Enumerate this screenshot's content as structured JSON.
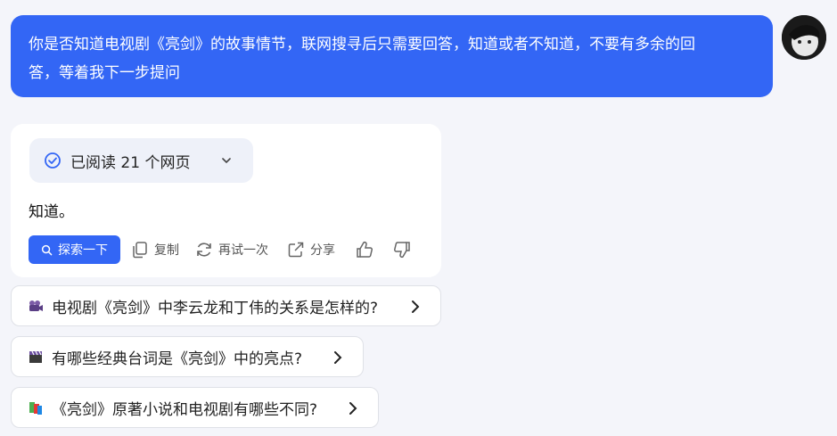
{
  "user_message": {
    "line1": "你是否知道电视剧《亮剑》的故事情节，联网搜寻后只需要回答，知道或者不知道，不要有多余的回",
    "line2": "答，等着我下一步提问"
  },
  "answer": {
    "read_label": "已阅读 21 个网页",
    "text": "知道。",
    "actions": {
      "explore": "探索一下",
      "copy": "复制",
      "retry": "再试一次",
      "share": "分享"
    }
  },
  "suggestions": [
    {
      "icon": "camera-icon",
      "text": "电视剧《亮剑》中李云龙和丁伟的关系是怎样的?"
    },
    {
      "icon": "clapperboard-icon",
      "text": "有哪些经典台词是《亮剑》中的亮点?"
    },
    {
      "icon": "books-icon",
      "text": "《亮剑》原著小说和电视剧有哪些不同?"
    }
  ],
  "colors": {
    "accent": "#3366f5",
    "background": "#f4f5fa"
  }
}
